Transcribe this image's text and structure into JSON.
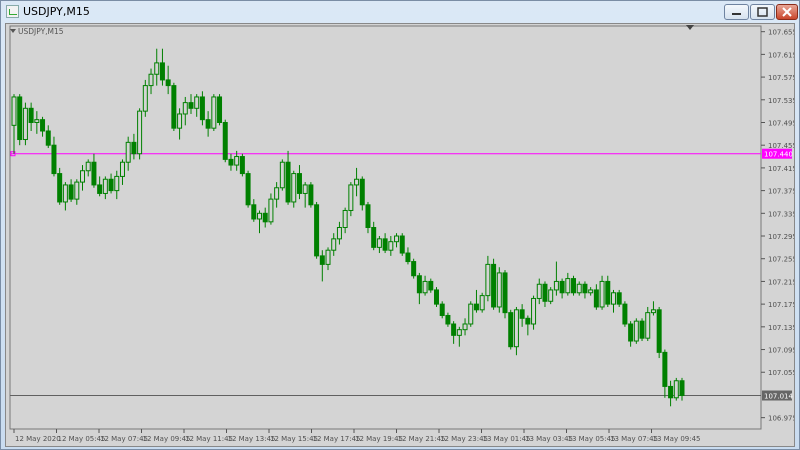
{
  "window": {
    "title": "USDJPY,M15",
    "minimize_icon": "minimize-icon",
    "maximize_icon": "maximize-icon",
    "close_icon": "close-icon"
  },
  "chart_header": {
    "label": "USDJPY,M15",
    "collapse_icon": "triangle-down-icon"
  },
  "colors": {
    "background": "#d4d4d4",
    "candle": "#008000",
    "line_level": "#ff00ff",
    "current_price_line": "#606060",
    "axis_text": "#505050"
  },
  "chart_data": {
    "type": "candlestick",
    "symbol": "USDJPY",
    "timeframe": "M15",
    "title": "USDJPY,M15",
    "ylim": [
      106.955,
      107.665
    ],
    "y_ticks": [
      "107.655",
      "107.615",
      "107.575",
      "107.535",
      "107.495",
      "107.455",
      "107.415",
      "107.375",
      "107.335",
      "107.295",
      "107.255",
      "107.215",
      "107.175",
      "107.135",
      "107.095",
      "107.055",
      "106.975"
    ],
    "x_ticks": [
      "12 May 2020",
      "12 May 05:45",
      "12 May 07:45",
      "12 May 09:45",
      "12 May 11:45",
      "12 May 13:45",
      "12 May 15:45",
      "12 May 17:45",
      "12 May 19:45",
      "12 May 21:45",
      "12 May 23:45",
      "13 May 01:45",
      "13 May 03:45",
      "13 May 05:45",
      "13 May 07:45",
      "13 May 09:45"
    ],
    "horizontal_line": {
      "price": 107.44,
      "label": "107.440"
    },
    "current_price": {
      "price": 107.014,
      "label": "107.014"
    },
    "candles": [
      {
        "o": 107.49,
        "h": 107.545,
        "l": 107.44,
        "c": 107.54
      },
      {
        "o": 107.54,
        "h": 107.545,
        "l": 107.455,
        "c": 107.465
      },
      {
        "o": 107.465,
        "h": 107.53,
        "l": 107.455,
        "c": 107.52
      },
      {
        "o": 107.52,
        "h": 107.53,
        "l": 107.48,
        "c": 107.495
      },
      {
        "o": 107.495,
        "h": 107.515,
        "l": 107.475,
        "c": 107.5
      },
      {
        "o": 107.5,
        "h": 107.505,
        "l": 107.47,
        "c": 107.48
      },
      {
        "o": 107.48,
        "h": 107.49,
        "l": 107.45,
        "c": 107.455
      },
      {
        "o": 107.455,
        "h": 107.47,
        "l": 107.4,
        "c": 107.405
      },
      {
        "o": 107.405,
        "h": 107.415,
        "l": 107.35,
        "c": 107.355
      },
      {
        "o": 107.355,
        "h": 107.39,
        "l": 107.34,
        "c": 107.385
      },
      {
        "o": 107.385,
        "h": 107.395,
        "l": 107.355,
        "c": 107.36
      },
      {
        "o": 107.36,
        "h": 107.395,
        "l": 107.35,
        "c": 107.39
      },
      {
        "o": 107.39,
        "h": 107.42,
        "l": 107.375,
        "c": 107.41
      },
      {
        "o": 107.41,
        "h": 107.43,
        "l": 107.4,
        "c": 107.425
      },
      {
        "o": 107.425,
        "h": 107.44,
        "l": 107.38,
        "c": 107.385
      },
      {
        "o": 107.385,
        "h": 107.4,
        "l": 107.365,
        "c": 107.37
      },
      {
        "o": 107.37,
        "h": 107.4,
        "l": 107.36,
        "c": 107.395
      },
      {
        "o": 107.395,
        "h": 107.405,
        "l": 107.37,
        "c": 107.375
      },
      {
        "o": 107.375,
        "h": 107.41,
        "l": 107.36,
        "c": 107.4
      },
      {
        "o": 107.4,
        "h": 107.43,
        "l": 107.385,
        "c": 107.425
      },
      {
        "o": 107.425,
        "h": 107.47,
        "l": 107.41,
        "c": 107.46
      },
      {
        "o": 107.46,
        "h": 107.475,
        "l": 107.43,
        "c": 107.44
      },
      {
        "o": 107.44,
        "h": 107.52,
        "l": 107.43,
        "c": 107.515
      },
      {
        "o": 107.515,
        "h": 107.57,
        "l": 107.505,
        "c": 107.56
      },
      {
        "o": 107.56,
        "h": 107.59,
        "l": 107.545,
        "c": 107.58
      },
      {
        "o": 107.58,
        "h": 107.625,
        "l": 107.56,
        "c": 107.6
      },
      {
        "o": 107.6,
        "h": 107.625,
        "l": 107.56,
        "c": 107.57
      },
      {
        "o": 107.57,
        "h": 107.595,
        "l": 107.545,
        "c": 107.56
      },
      {
        "o": 107.56,
        "h": 107.565,
        "l": 107.48,
        "c": 107.485
      },
      {
        "o": 107.485,
        "h": 107.52,
        "l": 107.465,
        "c": 107.51
      },
      {
        "o": 107.51,
        "h": 107.54,
        "l": 107.49,
        "c": 107.53
      },
      {
        "o": 107.53,
        "h": 107.545,
        "l": 107.51,
        "c": 107.52
      },
      {
        "o": 107.52,
        "h": 107.545,
        "l": 107.505,
        "c": 107.54
      },
      {
        "o": 107.54,
        "h": 107.55,
        "l": 107.49,
        "c": 107.5
      },
      {
        "o": 107.5,
        "h": 107.515,
        "l": 107.47,
        "c": 107.485
      },
      {
        "o": 107.485,
        "h": 107.545,
        "l": 107.48,
        "c": 107.54
      },
      {
        "o": 107.54,
        "h": 107.545,
        "l": 107.49,
        "c": 107.495
      },
      {
        "o": 107.495,
        "h": 107.5,
        "l": 107.425,
        "c": 107.43
      },
      {
        "o": 107.43,
        "h": 107.44,
        "l": 107.41,
        "c": 107.42
      },
      {
        "o": 107.42,
        "h": 107.445,
        "l": 107.41,
        "c": 107.435
      },
      {
        "o": 107.435,
        "h": 107.44,
        "l": 107.4,
        "c": 107.405
      },
      {
        "o": 107.405,
        "h": 107.41,
        "l": 107.345,
        "c": 107.35
      },
      {
        "o": 107.35,
        "h": 107.36,
        "l": 107.32,
        "c": 107.325
      },
      {
        "o": 107.325,
        "h": 107.34,
        "l": 107.3,
        "c": 107.335
      },
      {
        "o": 107.335,
        "h": 107.345,
        "l": 107.31,
        "c": 107.32
      },
      {
        "o": 107.32,
        "h": 107.37,
        "l": 107.315,
        "c": 107.36
      },
      {
        "o": 107.36,
        "h": 107.39,
        "l": 107.345,
        "c": 107.38
      },
      {
        "o": 107.38,
        "h": 107.43,
        "l": 107.375,
        "c": 107.425
      },
      {
        "o": 107.425,
        "h": 107.445,
        "l": 107.35,
        "c": 107.355
      },
      {
        "o": 107.355,
        "h": 107.41,
        "l": 107.345,
        "c": 107.405
      },
      {
        "o": 107.405,
        "h": 107.42,
        "l": 107.36,
        "c": 107.37
      },
      {
        "o": 107.37,
        "h": 107.39,
        "l": 107.345,
        "c": 107.385
      },
      {
        "o": 107.385,
        "h": 107.39,
        "l": 107.345,
        "c": 107.35
      },
      {
        "o": 107.35,
        "h": 107.355,
        "l": 107.255,
        "c": 107.26
      },
      {
        "o": 107.26,
        "h": 107.27,
        "l": 107.215,
        "c": 107.245
      },
      {
        "o": 107.245,
        "h": 107.275,
        "l": 107.235,
        "c": 107.27
      },
      {
        "o": 107.27,
        "h": 107.3,
        "l": 107.26,
        "c": 107.29
      },
      {
        "o": 107.29,
        "h": 107.32,
        "l": 107.28,
        "c": 107.31
      },
      {
        "o": 107.31,
        "h": 107.345,
        "l": 107.3,
        "c": 107.34
      },
      {
        "o": 107.34,
        "h": 107.39,
        "l": 107.33,
        "c": 107.385
      },
      {
        "o": 107.385,
        "h": 107.415,
        "l": 107.365,
        "c": 107.395
      },
      {
        "o": 107.395,
        "h": 107.4,
        "l": 107.34,
        "c": 107.35
      },
      {
        "o": 107.35,
        "h": 107.355,
        "l": 107.3,
        "c": 107.31
      },
      {
        "o": 107.31,
        "h": 107.32,
        "l": 107.27,
        "c": 107.275
      },
      {
        "o": 107.275,
        "h": 107.295,
        "l": 107.265,
        "c": 107.29
      },
      {
        "o": 107.29,
        "h": 107.3,
        "l": 107.265,
        "c": 107.27
      },
      {
        "o": 107.27,
        "h": 107.295,
        "l": 107.26,
        "c": 107.285
      },
      {
        "o": 107.285,
        "h": 107.3,
        "l": 107.275,
        "c": 107.295
      },
      {
        "o": 107.295,
        "h": 107.3,
        "l": 107.26,
        "c": 107.265
      },
      {
        "o": 107.265,
        "h": 107.275,
        "l": 107.245,
        "c": 107.25
      },
      {
        "o": 107.25,
        "h": 107.255,
        "l": 107.22,
        "c": 107.225
      },
      {
        "o": 107.225,
        "h": 107.23,
        "l": 107.175,
        "c": 107.195
      },
      {
        "o": 107.195,
        "h": 107.225,
        "l": 107.19,
        "c": 107.215
      },
      {
        "o": 107.215,
        "h": 107.22,
        "l": 107.195,
        "c": 107.2
      },
      {
        "o": 107.2,
        "h": 107.205,
        "l": 107.17,
        "c": 107.175
      },
      {
        "o": 107.175,
        "h": 107.18,
        "l": 107.15,
        "c": 107.155
      },
      {
        "o": 107.155,
        "h": 107.16,
        "l": 107.135,
        "c": 107.14
      },
      {
        "o": 107.14,
        "h": 107.145,
        "l": 107.105,
        "c": 107.12
      },
      {
        "o": 107.12,
        "h": 107.135,
        "l": 107.1,
        "c": 107.13
      },
      {
        "o": 107.13,
        "h": 107.15,
        "l": 107.12,
        "c": 107.14
      },
      {
        "o": 107.14,
        "h": 107.18,
        "l": 107.135,
        "c": 107.175
      },
      {
        "o": 107.175,
        "h": 107.2,
        "l": 107.16,
        "c": 107.165
      },
      {
        "o": 107.165,
        "h": 107.195,
        "l": 107.16,
        "c": 107.19
      },
      {
        "o": 107.19,
        "h": 107.26,
        "l": 107.18,
        "c": 107.245
      },
      {
        "o": 107.245,
        "h": 107.255,
        "l": 107.165,
        "c": 107.17
      },
      {
        "o": 107.17,
        "h": 107.24,
        "l": 107.16,
        "c": 107.23
      },
      {
        "o": 107.23,
        "h": 107.235,
        "l": 107.15,
        "c": 107.16
      },
      {
        "o": 107.16,
        "h": 107.165,
        "l": 107.095,
        "c": 107.1
      },
      {
        "o": 107.1,
        "h": 107.17,
        "l": 107.085,
        "c": 107.165
      },
      {
        "o": 107.165,
        "h": 107.175,
        "l": 107.135,
        "c": 107.15
      },
      {
        "o": 107.15,
        "h": 107.155,
        "l": 107.12,
        "c": 107.14
      },
      {
        "o": 107.14,
        "h": 107.19,
        "l": 107.13,
        "c": 107.185
      },
      {
        "o": 107.185,
        "h": 107.22,
        "l": 107.175,
        "c": 107.21
      },
      {
        "o": 107.21,
        "h": 107.215,
        "l": 107.17,
        "c": 107.18
      },
      {
        "o": 107.18,
        "h": 107.205,
        "l": 107.175,
        "c": 107.2
      },
      {
        "o": 107.2,
        "h": 107.25,
        "l": 107.19,
        "c": 107.215
      },
      {
        "o": 107.215,
        "h": 107.22,
        "l": 107.185,
        "c": 107.195
      },
      {
        "o": 107.195,
        "h": 107.23,
        "l": 107.19,
        "c": 107.22
      },
      {
        "o": 107.22,
        "h": 107.225,
        "l": 107.19,
        "c": 107.195
      },
      {
        "o": 107.195,
        "h": 107.215,
        "l": 107.19,
        "c": 107.21
      },
      {
        "o": 107.21,
        "h": 107.215,
        "l": 107.185,
        "c": 107.195
      },
      {
        "o": 107.195,
        "h": 107.205,
        "l": 107.19,
        "c": 107.2
      },
      {
        "o": 107.2,
        "h": 107.21,
        "l": 107.165,
        "c": 107.17
      },
      {
        "o": 107.17,
        "h": 107.225,
        "l": 107.165,
        "c": 107.215
      },
      {
        "o": 107.215,
        "h": 107.225,
        "l": 107.17,
        "c": 107.175
      },
      {
        "o": 107.175,
        "h": 107.2,
        "l": 107.16,
        "c": 107.195
      },
      {
        "o": 107.195,
        "h": 107.2,
        "l": 107.17,
        "c": 107.175
      },
      {
        "o": 107.175,
        "h": 107.18,
        "l": 107.135,
        "c": 107.14
      },
      {
        "o": 107.14,
        "h": 107.145,
        "l": 107.1,
        "c": 107.11
      },
      {
        "o": 107.11,
        "h": 107.15,
        "l": 107.105,
        "c": 107.145
      },
      {
        "o": 107.145,
        "h": 107.15,
        "l": 107.11,
        "c": 107.115
      },
      {
        "o": 107.115,
        "h": 107.17,
        "l": 107.11,
        "c": 107.16
      },
      {
        "o": 107.16,
        "h": 107.18,
        "l": 107.155,
        "c": 107.165
      },
      {
        "o": 107.165,
        "h": 107.17,
        "l": 107.08,
        "c": 107.09
      },
      {
        "o": 107.09,
        "h": 107.095,
        "l": 107.01,
        "c": 107.03
      },
      {
        "o": 107.03,
        "h": 107.04,
        "l": 106.995,
        "c": 107.01
      },
      {
        "o": 107.01,
        "h": 107.045,
        "l": 107.005,
        "c": 107.04
      },
      {
        "o": 107.04,
        "h": 107.045,
        "l": 107.005,
        "c": 107.014
      }
    ]
  }
}
